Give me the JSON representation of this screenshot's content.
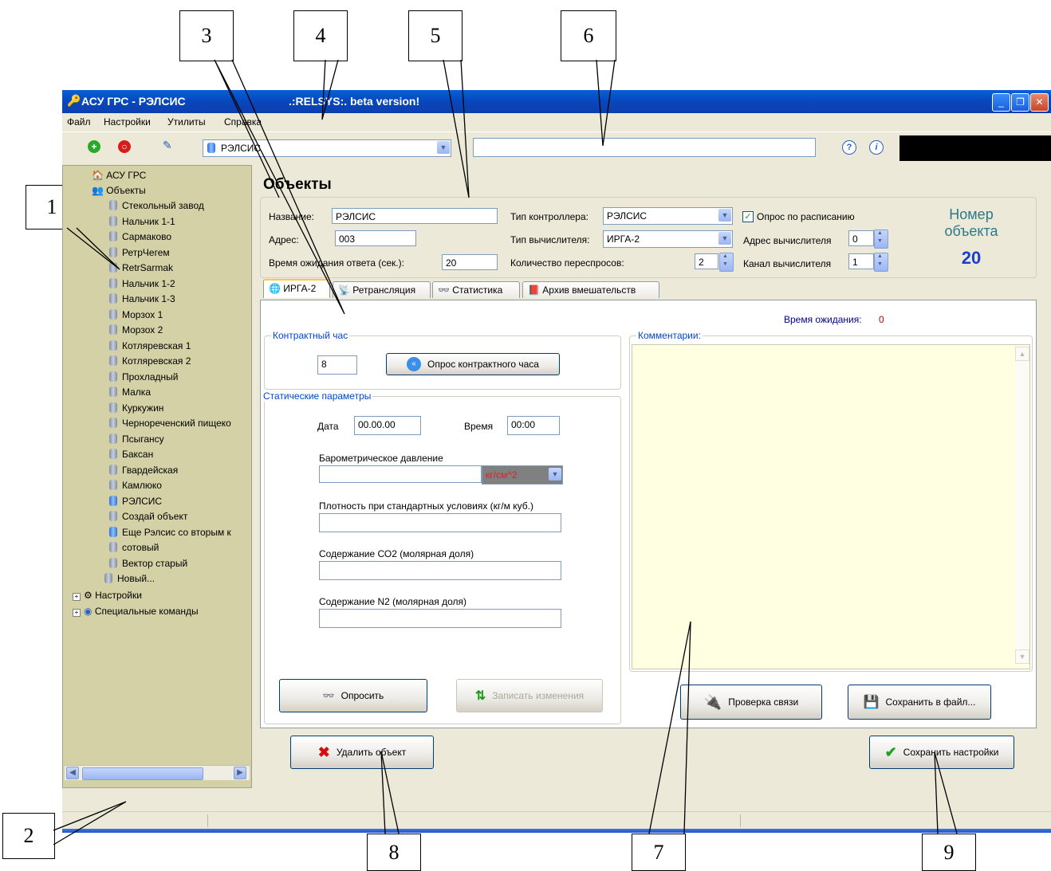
{
  "window": {
    "title": "АСУ ГРС - РЭЛСИС",
    "subtitle": ".:RELSYS:. beta version!",
    "controls": {
      "minimize": "_",
      "maximize": "❐",
      "close": "✕"
    }
  },
  "menu": [
    "Файл",
    "Настройки",
    "Утилиты",
    "Справка"
  ],
  "toolbar": {
    "object_combo_value": "РЭЛСИС",
    "message_field_value": ""
  },
  "tree": {
    "root": "АСУ ГРС",
    "objects_folder": "Объекты",
    "items": [
      "Стекольный завод",
      "Нальчик 1-1",
      "Сармаково",
      "РетрЧегем",
      "RetrSarmak",
      "Нальчик 1-2",
      "Нальчик 1-3",
      "Морзох 1",
      "Морзох 2",
      "Котляревская 1",
      "Котляревская 2",
      "Прохладный",
      "Малка",
      "Куркужин",
      "Черноречeнский пищеко",
      "Псыгансу",
      "Баксан",
      "Гвардейская",
      "Камлюко",
      "РЭЛСИС",
      "Создай объект",
      "Еще Рэлсис со вторым к",
      "сотовый",
      "Вектор старый",
      "Новый..."
    ],
    "settings": "Настройки",
    "special": "Специальные команды"
  },
  "main": {
    "heading": "Объекты",
    "name_label": "Название:",
    "name_value": "РЭЛСИС",
    "address_label": "Адрес:",
    "address_value": "003",
    "timeout_label": "Время ожидания ответа   (сек.):",
    "timeout_value": "20",
    "controller_type_label": "Тип контроллера:",
    "controller_type_value": "РЭЛСИС",
    "calc_type_label": "Тип вычислителя:",
    "calc_type_value": "ИРГА-2",
    "retries_label": "Количество   переспросов:",
    "retries_value": "2",
    "schedule_label": "Опрос по расписанию",
    "calc_address_label": "Адрес вычислителя",
    "calc_address_value": "0",
    "calc_channel_label": "Канал вычислителя",
    "calc_channel_value": "1",
    "object_number_label_1": "Номер",
    "object_number_label_2": "объекта",
    "object_number_value": "20"
  },
  "tabs": [
    "ИРГА-2",
    "Ретрансляция",
    "Статистика",
    "Архив вмешательств"
  ],
  "irga": {
    "wait_time_label": "Время ожидания:",
    "wait_time_value": "0",
    "contract_hour_group": "Контрактный час",
    "contract_hour_value": "8",
    "poll_contract_button": "Опрос контрактного часа",
    "static_group": "Статические параметры",
    "date_label": "Дата",
    "date_value": "00.00.00",
    "time_label": "Время",
    "time_value": "00:00",
    "pressure_label": "Барометрическое давление",
    "pressure_unit": "кг/см^2",
    "density_label": "Плотность при стандартных условиях (кг/м куб.)",
    "co2_label": "Содержание СО2 (молярная доля)",
    "n2_label": "Содержание N2 (молярная доля)",
    "poll_button": "Опросить",
    "write_button": "Записать изменения",
    "comments_group": "Комментарии:",
    "check_link_button": "Проверка связи",
    "save_file_button": "Сохранить в файл..."
  },
  "footer": {
    "delete_button": "Удалить объект",
    "save_settings_button": "Сохранить настройки"
  },
  "callouts": [
    "1",
    "2",
    "3",
    "4",
    "5",
    "6",
    "7",
    "8",
    "9"
  ]
}
